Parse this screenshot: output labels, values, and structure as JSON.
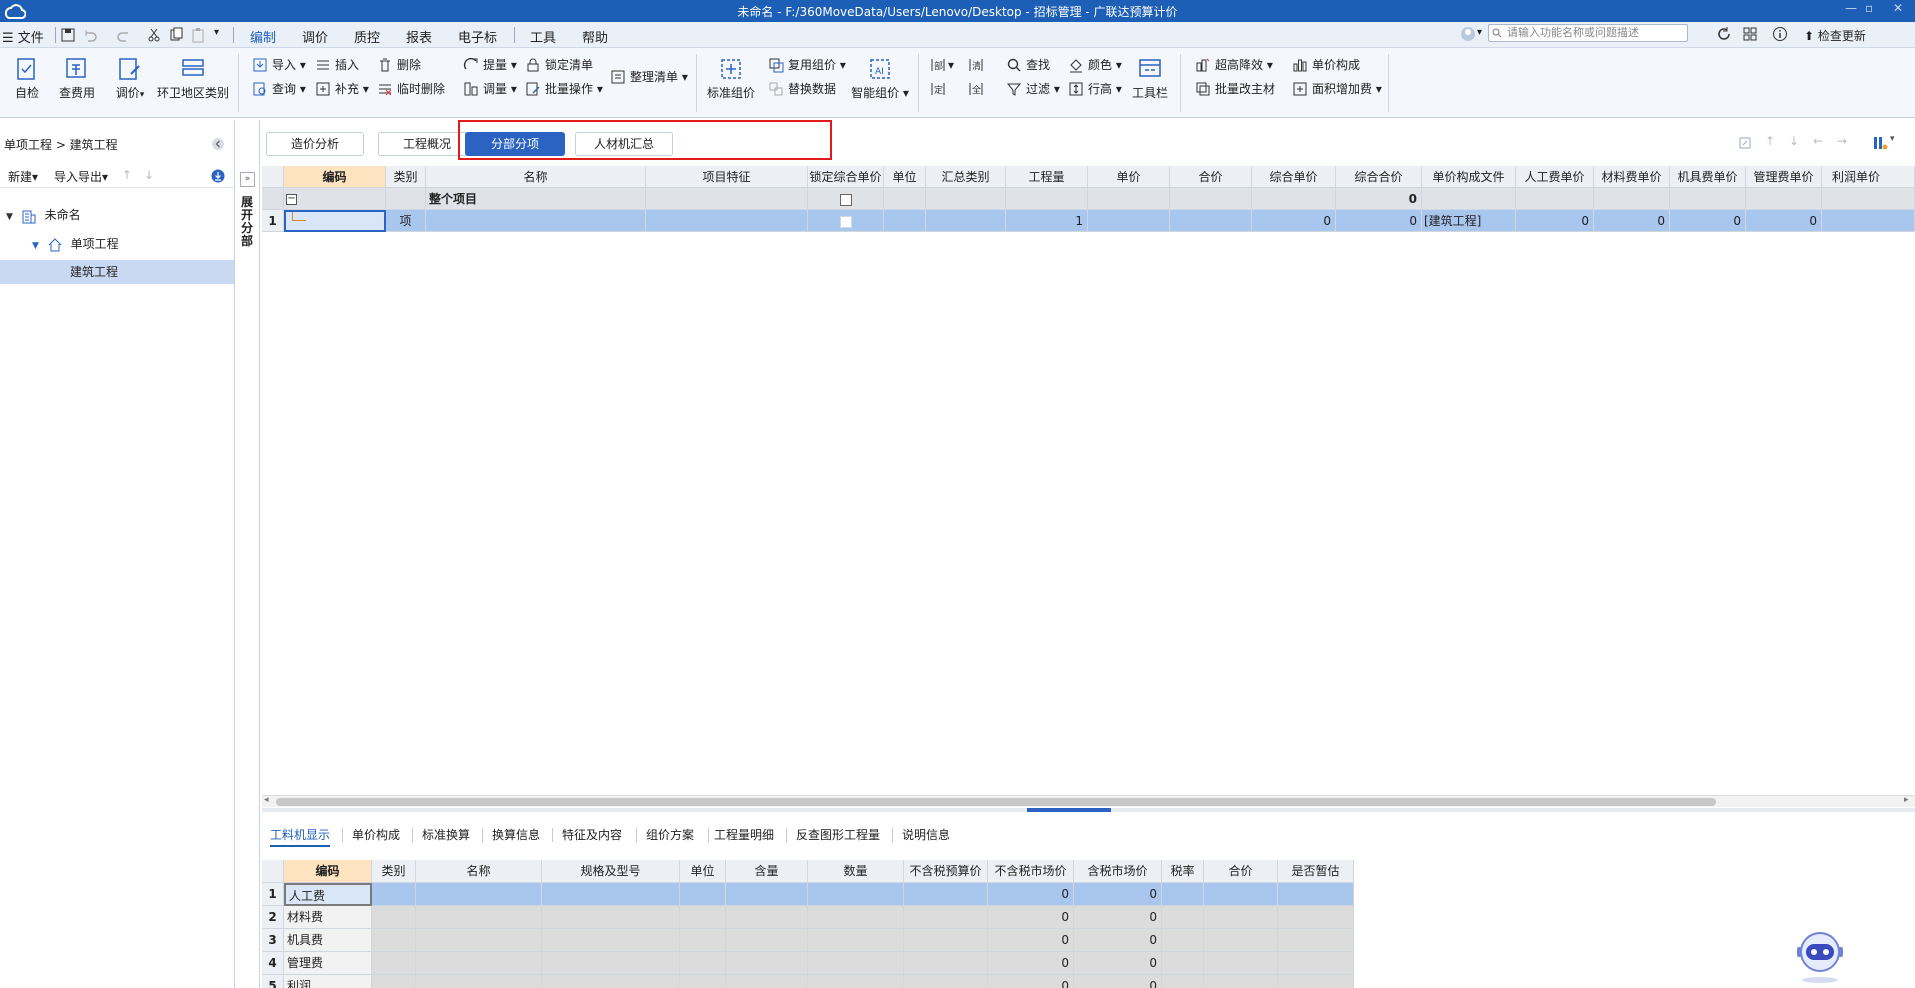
{
  "window": {
    "title": "未命名 - F:/360MoveData/Users/Lenovo/Desktop - 招标管理 - 广联达预算计价"
  },
  "menu": {
    "file": "文件",
    "items": [
      "编制",
      "调价",
      "质控",
      "报表",
      "电子标",
      "工具",
      "帮助"
    ],
    "search_placeholder": "请输入功能名称或问题描述",
    "check_update": "检查更新"
  },
  "ribbon": {
    "big": [
      "自检",
      "查费用",
      "调价",
      "环卫地区类别"
    ],
    "g1": [
      "导入",
      "查询",
      "插入",
      "补充",
      "删除",
      "临时删除"
    ],
    "g2": [
      "提量",
      "调量",
      "锁定清单",
      "批量操作",
      "整理清单"
    ],
    "g3": [
      "标准组价",
      "复用组价",
      "替换数据",
      "智能组价"
    ],
    "g4": [
      "查找",
      "过滤",
      "颜色",
      "行高",
      "工具栏"
    ],
    "g5": [
      "超高降效",
      "批量改主材",
      "单价构成",
      "面积增加费"
    ]
  },
  "left": {
    "breadcrumb": "单项工程 > 建筑工程",
    "new": "新建",
    "import_export": "导入导出",
    "tree": [
      "未命名",
      "单项工程",
      "建筑工程"
    ]
  },
  "side_strip": "展开分部",
  "tabs": [
    "造价分析",
    "工程概况",
    "分部分项",
    "人材机汇总"
  ],
  "main_table": {
    "headers": [
      "编码",
      "类别",
      "名称",
      "项目特征",
      "锁定综合单价",
      "单位",
      "汇总类别",
      "工程量",
      "单价",
      "合价",
      "综合单价",
      "综合合价",
      "单价构成文件",
      "人工费单价",
      "材料费单价",
      "机具费单价",
      "管理费单价",
      "利润单价"
    ],
    "row_whole": {
      "name": "整个项目",
      "total": "0"
    },
    "row1": {
      "no": "1",
      "type": "项",
      "qty": "1",
      "unit_price": "0",
      "total_price": "0",
      "file": "[建筑工程]",
      "labor": "0",
      "material": "0",
      "machine": "0",
      "mgmt": "0"
    }
  },
  "bottom_tabs": [
    "工料机显示",
    "单价构成",
    "标准换算",
    "换算信息",
    "特征及内容",
    "组价方案",
    "工程量明细",
    "反查图形工程量",
    "说明信息"
  ],
  "bottom_table": {
    "headers": [
      "编码",
      "类别",
      "名称",
      "规格及型号",
      "单位",
      "含量",
      "数量",
      "不含税预算价",
      "不含税市场价",
      "含税市场价",
      "税率",
      "合价",
      "是否暂估"
    ],
    "rows": [
      {
        "no": "1",
        "code": "人工费",
        "m": "0",
        "t": "0"
      },
      {
        "no": "2",
        "code": "材料费",
        "m": "0",
        "t": "0"
      },
      {
        "no": "3",
        "code": "机具费",
        "m": "0",
        "t": "0"
      },
      {
        "no": "4",
        "code": "管理费",
        "m": "0",
        "t": "0"
      },
      {
        "no": "5",
        "code": "利润",
        "m": "0",
        "t": "0"
      }
    ]
  },
  "colors": {
    "accent": "#2b63c3",
    "title_bar": "#1d5fb6",
    "selected_row": "#a8c6ee",
    "highlight_box": "#e21b1b"
  }
}
